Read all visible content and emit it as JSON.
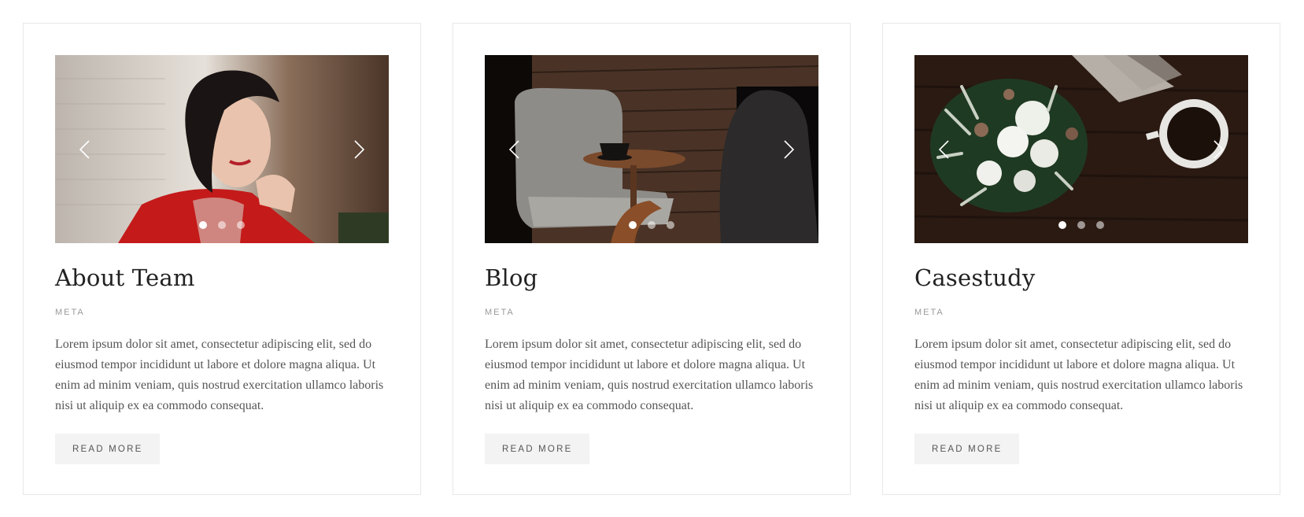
{
  "cards": [
    {
      "title": "About Team",
      "meta": "META",
      "body": "Lorem ipsum dolor sit amet, consectetur adipiscing elit, sed do eiusmod tempor incididunt ut labore et dolore magna aliqua. Ut enim ad minim veniam, quis nostrud exercitation ullamco laboris nisi ut aliquip ex ea commodo consequat.",
      "button": "READ MORE",
      "slides": 3,
      "active_slide": 1
    },
    {
      "title": "Blog",
      "meta": "META",
      "body": "Lorem ipsum dolor sit amet, consectetur adipiscing elit, sed do eiusmod tempor incididunt ut labore et dolore magna aliqua. Ut enim ad minim veniam, quis nostrud exercitation ullamco laboris nisi ut aliquip ex ea commodo consequat.",
      "button": "READ MORE",
      "slides": 3,
      "active_slide": 1
    },
    {
      "title": "Casestudy",
      "meta": "META",
      "body": "Lorem ipsum dolor sit amet, consectetur adipiscing elit, sed do eiusmod tempor incididunt ut labore et dolore magna aliqua. Ut enim ad minim veniam, quis nostrud exercitation ullamco laboris nisi ut aliquip ex ea commodo consequat.",
      "button": "READ MORE",
      "slides": 3,
      "active_slide": 1
    }
  ],
  "icons": {
    "prev": "chevron-left-icon",
    "next": "chevron-right-icon"
  },
  "colors": {
    "card_border": "#e8e8e8",
    "button_bg": "#f3f3f3",
    "title": "#222222",
    "meta": "#9a9a9a"
  }
}
